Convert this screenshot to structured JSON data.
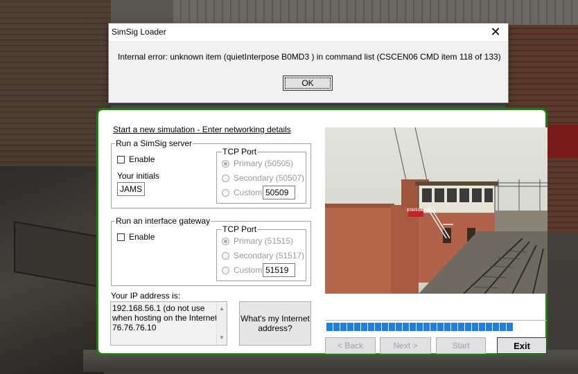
{
  "message_box": {
    "title": "SimSig Loader",
    "close_glyph": "✕",
    "message": "Internal error: unknown item (quietInterpose B0MD3 ) in command list (CSCEN06 CMD item 118 of 133)",
    "ok_label": "OK"
  },
  "dialog": {
    "heading": "Start a new simulation - Enter networking details",
    "server": {
      "legend": "Run a SimSig server",
      "enable_label": "Enable",
      "enabled": false,
      "initials_label": "Your initials",
      "initials_value": "JAMS",
      "port_legend": "TCP Port",
      "primary_label": "Primary (50505)",
      "secondary_label": "Secondary (50507)",
      "custom_label": "Custom:",
      "custom_value": "50509",
      "selected_port": "primary"
    },
    "gateway": {
      "legend": "Run an interface gateway",
      "enable_label": "Enable",
      "enabled": false,
      "port_legend": "TCP Port",
      "primary_label": "Primary (51515)",
      "secondary_label": "Secondary (51517)",
      "custom_label": "Custom:",
      "custom_value": "51519",
      "selected_port": "primary"
    },
    "ip": {
      "label": "Your IP address is:",
      "line1": "192.168.56.1 (do not use",
      "line2": "when hosting on the Internet)",
      "line3": "76.76.76.10"
    },
    "whats_my_ip_line1": "What's my Internet",
    "whats_my_ip_line2": "address?",
    "buttons": {
      "back": "< Back",
      "next": "Next >",
      "start": "Start",
      "exit": "Exit"
    },
    "progress_fraction": 0.84,
    "photo_sign_text": "STAFFORD NO. 5"
  },
  "colors": {
    "dialog_border": "#1c7f12",
    "progress": "#1e7fe0"
  },
  "icons": [
    "close-icon",
    "scroll-up-icon",
    "scroll-down-icon"
  ]
}
